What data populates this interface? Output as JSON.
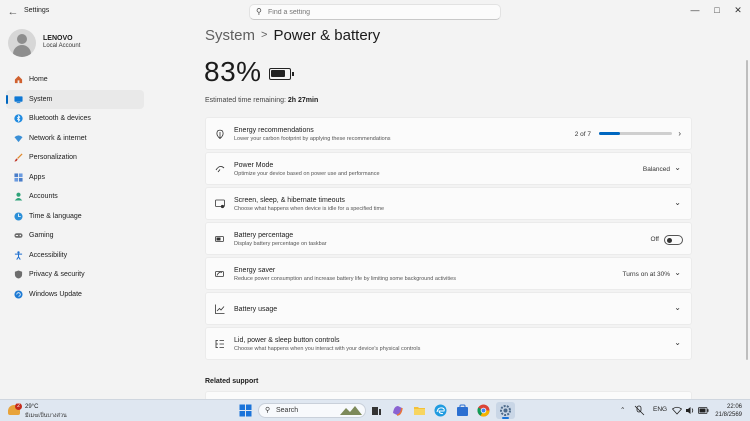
{
  "app": {
    "title": "Settings"
  },
  "search": {
    "placeholder": "Find a setting"
  },
  "user": {
    "name": "LENOVO",
    "account": "Local Account"
  },
  "sidebar": {
    "items": [
      {
        "label": "Home",
        "icon": "home-icon",
        "color": "#d0612f",
        "active": false
      },
      {
        "label": "System",
        "icon": "system-icon",
        "color": "#0f78d4",
        "active": true
      },
      {
        "label": "Bluetooth & devices",
        "icon": "bluetooth-icon",
        "color": "#1f8ae0",
        "active": false
      },
      {
        "label": "Network & internet",
        "icon": "wifi-icon",
        "color": "#3a8fd6",
        "active": false
      },
      {
        "label": "Personalization",
        "icon": "brush-icon",
        "color": "#e08a2e",
        "active": false
      },
      {
        "label": "Apps",
        "icon": "apps-icon",
        "color": "#4a7ec9",
        "active": false
      },
      {
        "label": "Accounts",
        "icon": "accounts-icon",
        "color": "#2fa37a",
        "active": false
      },
      {
        "label": "Time & language",
        "icon": "globe-clock-icon",
        "color": "#2b8fd8",
        "active": false
      },
      {
        "label": "Gaming",
        "icon": "gamepad-icon",
        "color": "#6b6b6b",
        "active": false
      },
      {
        "label": "Accessibility",
        "icon": "accessibility-icon",
        "color": "#1f6fcf",
        "active": false
      },
      {
        "label": "Privacy & security",
        "icon": "shield-icon",
        "color": "#6d6d6d",
        "active": false
      },
      {
        "label": "Windows Update",
        "icon": "update-icon",
        "color": "#1c7ad4",
        "active": false
      }
    ]
  },
  "breadcrumb": {
    "parent": "System",
    "separator": ">",
    "current": "Power & battery"
  },
  "battery": {
    "percent_text": "83%",
    "level": 0.83,
    "estimate_label": "Estimated time remaining:",
    "estimate_value": "2h 27min"
  },
  "cards": {
    "energy_rec": {
      "title": "Energy recommendations",
      "desc": "Lower your carbon footprint by applying these recommendations",
      "count": "2 of 7",
      "progress": 0.2857,
      "icon": "leaf-icon"
    },
    "power_mode": {
      "title": "Power Mode",
      "desc": "Optimize your device based on power use and performance",
      "value": "Balanced",
      "icon": "power-mode-icon"
    },
    "screen_sleep": {
      "title": "Screen, sleep, & hibernate timeouts",
      "desc": "Choose what happens when device is idle for a specified time",
      "icon": "screen-sleep-icon"
    },
    "battery_pct": {
      "title": "Battery percentage",
      "desc": "Display battery percentage on taskbar",
      "state": "Off",
      "icon": "battery-percent-icon"
    },
    "energy_saver": {
      "title": "Energy saver",
      "desc": "Reduce power consumption and increase battery life by limiting some background activities",
      "value": "Turns on at 30%",
      "icon": "energy-saver-icon"
    },
    "battery_usage": {
      "title": "Battery usage",
      "icon": "chart-icon"
    },
    "lid_power": {
      "title": "Lid, power & sleep button controls",
      "desc": "Choose what happens when you interact with your device's physical controls",
      "icon": "lid-icon"
    }
  },
  "related": {
    "title": "Related support"
  },
  "taskbar": {
    "weather": {
      "temp": "29°C",
      "condition": "มีเมฆเป็นบางส่วน",
      "badge": "2"
    },
    "search_label": "Search",
    "lang": "ENG",
    "time": "22:06",
    "date": "21/8/2569"
  }
}
